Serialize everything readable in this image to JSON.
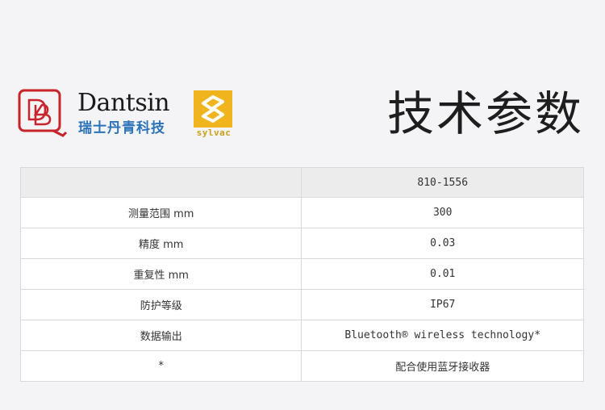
{
  "header": {
    "brand_name": "Dantsin",
    "brand_name_cn": "瑞士丹青科技",
    "partner_name": "sylvac",
    "title": "技术参数",
    "colors": {
      "dantsin_red": "#c8242b",
      "dantsin_blue": "#2a73b8",
      "sylvac_gold": "#f0b41e"
    }
  },
  "table": {
    "header": {
      "label": "",
      "value": "810-1556"
    },
    "rows": [
      {
        "label": "测量范围 mm",
        "value": "300"
      },
      {
        "label": "精度 mm",
        "value": "0.03"
      },
      {
        "label": "重复性 mm",
        "value": "0.01"
      },
      {
        "label": "防护等级",
        "value": "IP67"
      },
      {
        "label": "数据输出",
        "value": "Bluetooth® wireless technology*"
      },
      {
        "label": "*",
        "value": "配合使用蓝牙接收器"
      }
    ]
  }
}
